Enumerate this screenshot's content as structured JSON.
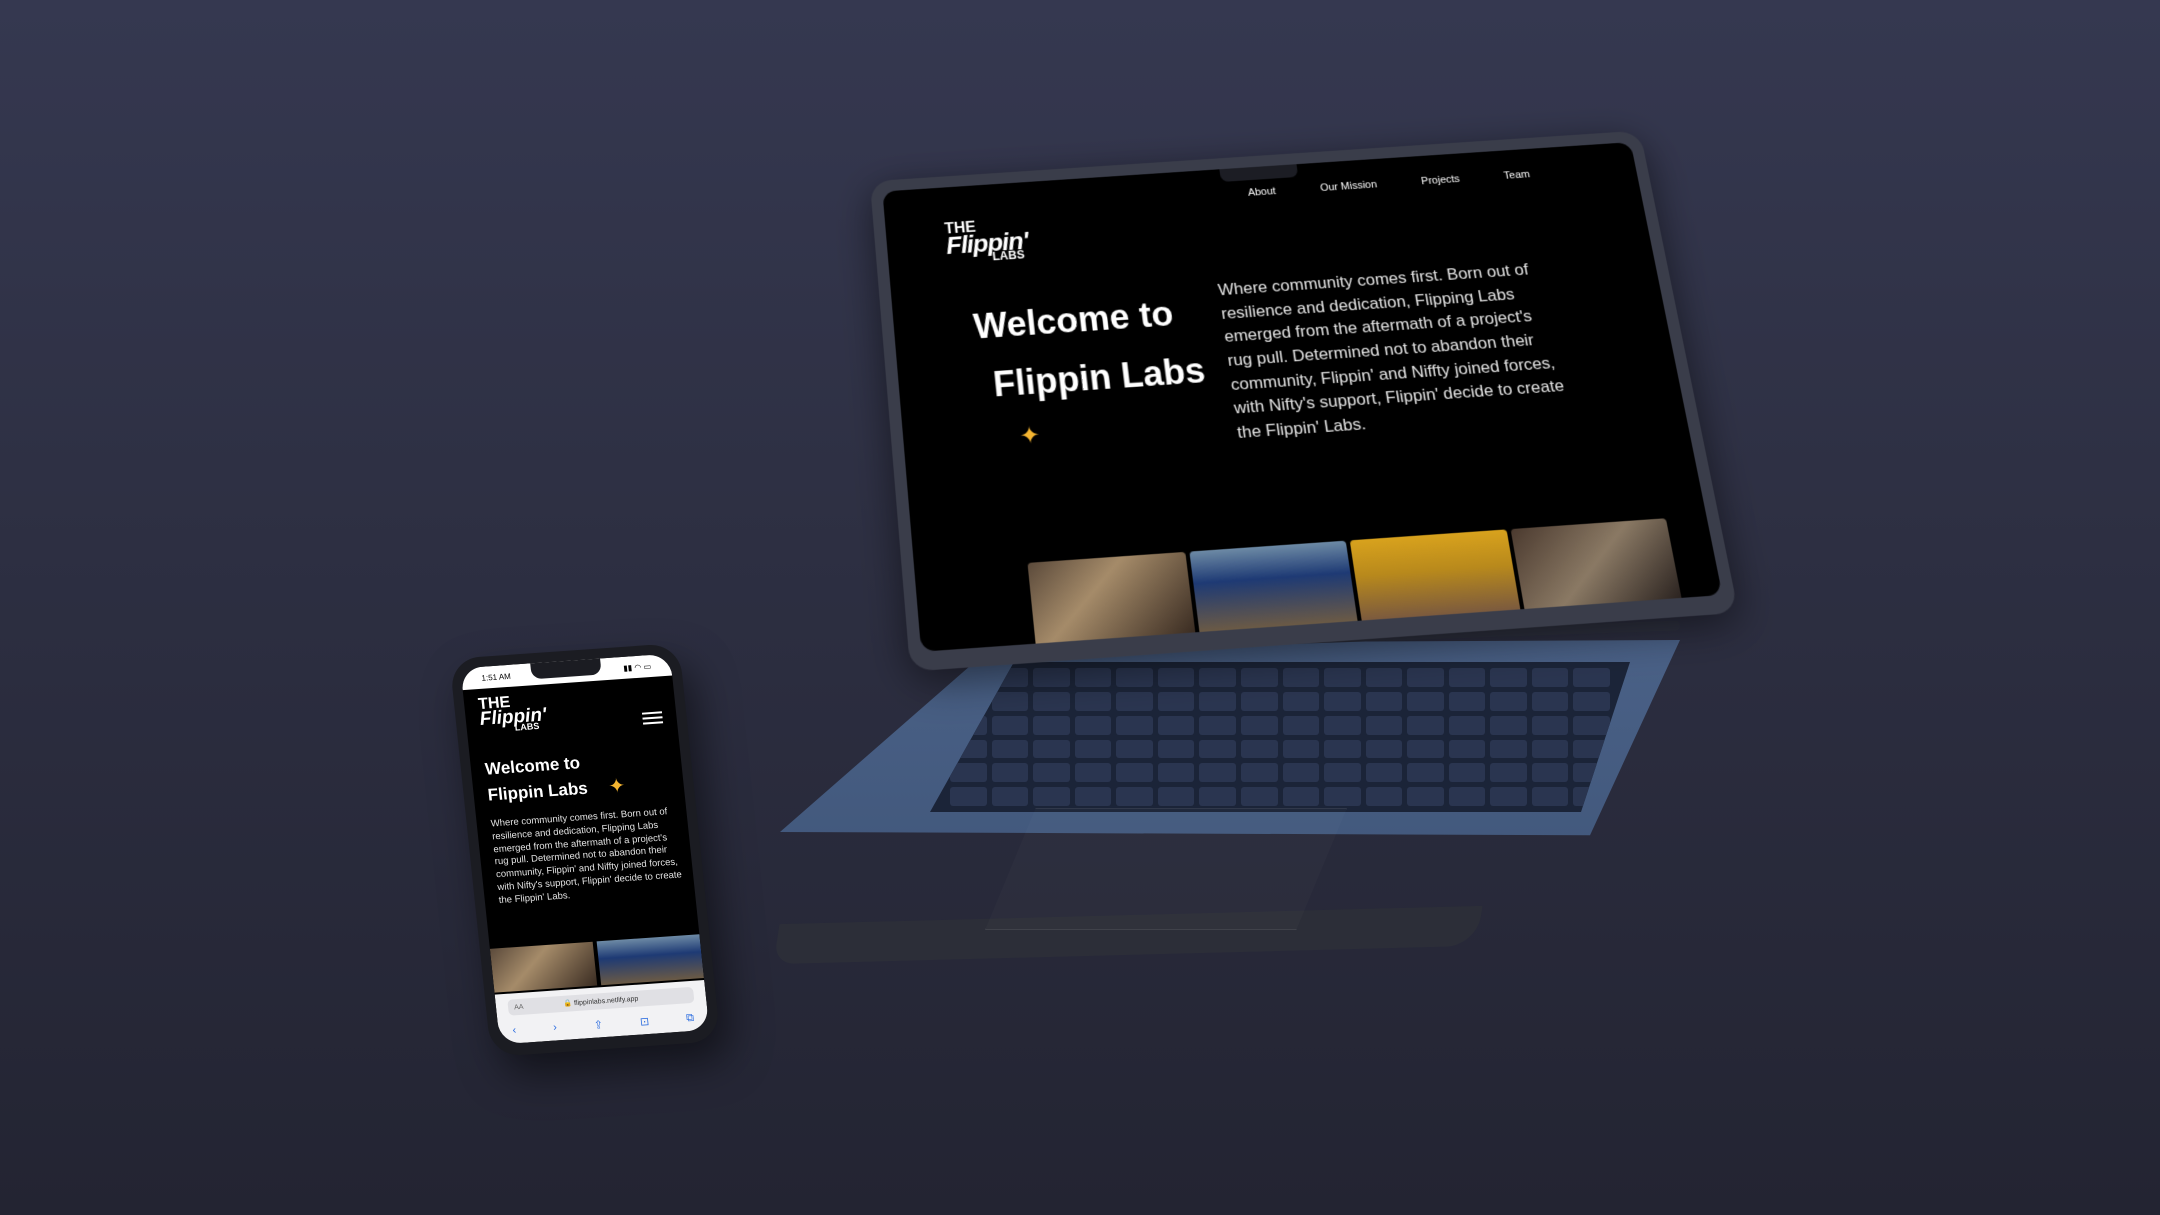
{
  "laptop": {
    "logo": {
      "the": "THE",
      "flippin": "Flippin'",
      "labs": "LABS"
    },
    "nav": [
      "About",
      "Our Mission",
      "Projects",
      "Team"
    ],
    "hero_title_line1": "Welcome to",
    "hero_title_line2": "Flippin Labs",
    "star_icon": "✦",
    "hero_text": "Where community comes first. Born out of resilience and dedication, Flipping Labs emerged from the aftermath of a project's rug pull. Determined not to abandon their community, Flippin' and Niffty joined forces, with Nifty's support, Flippin' decide to create the Flippin' Labs.",
    "accent_color": "#f5b531"
  },
  "phone": {
    "status_time": "1:51 AM",
    "status_icons": "▮▮ ◠ ▭",
    "logo": {
      "the": "THE",
      "flippin": "Flippin'",
      "labs": "LABS"
    },
    "hero_title_line1": "Welcome to",
    "hero_title_line2": "Flippin Labs",
    "star_icon": "✦",
    "hero_text": "Where community comes first. Born out of resilience and dedication, Flipping Labs emerged from the aftermath of a project's rug pull. Determined not to abandon their community, Flippin' and Niffty joined forces, with Nifty's support, Flippin' decide to create the Flippin' Labs.",
    "browser": {
      "aa": "AA",
      "url": "🔒 flippinlabs.netlify.app",
      "toolbar": [
        "‹",
        "›",
        "⇪",
        "⊡",
        "⧉"
      ]
    }
  }
}
